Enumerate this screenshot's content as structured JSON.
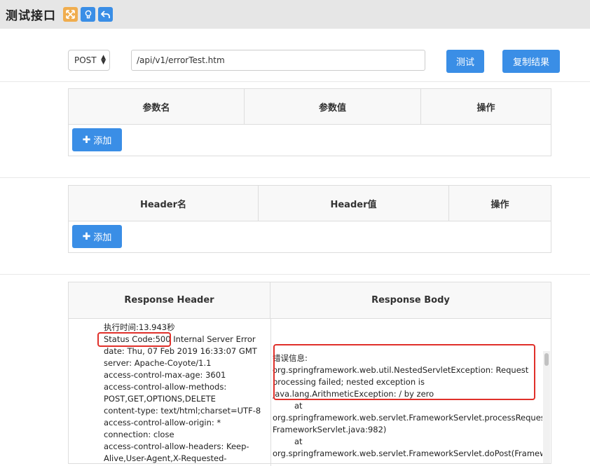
{
  "header": {
    "title": "测试接口",
    "icons": [
      "fullscreen-icon",
      "lightbulb-icon",
      "back-icon"
    ]
  },
  "request": {
    "method": "POST",
    "url": "/api/v1/errorTest.htm",
    "test_label": "测试",
    "copy_label": "复制结果"
  },
  "params_table": {
    "columns": [
      "参数名",
      "参数值",
      "操作"
    ],
    "add_label": "添加"
  },
  "header_table": {
    "columns": [
      "Header名",
      "Header值",
      "操作"
    ],
    "add_label": "添加"
  },
  "response": {
    "header_title": "Response Header",
    "body_title": "Response Body",
    "header_lines": [
      "执行时间:13.943秒",
      "Status Code:500 Internal Server Error",
      "date: Thu, 07 Feb 2019 16:33:07 GMT",
      "server: Apache-Coyote/1.1",
      "access-control-max-age: 3601",
      "access-control-allow-methods:",
      "POST,GET,OPTIONS,DELETE",
      "content-type: text/html;charset=UTF-8",
      "access-control-allow-origin: *",
      "connection: close",
      "access-control-allow-headers: Keep-",
      "Alive,User-Agent,X-Requested-"
    ],
    "body_lines": [
      "错误信息:",
      "org.springframework.web.util.NestedServletException: Request",
      "processing failed; nested exception is",
      "java.lang.ArithmeticException: / by zero",
      "at",
      "org.springframework.web.servlet.FrameworkServlet.processRequest(",
      "FrameworkServlet.java:982)",
      "at",
      "org.springframework.web.servlet.FrameworkServlet.doPost(Framew"
    ],
    "highlight_color": "#e0302a"
  }
}
